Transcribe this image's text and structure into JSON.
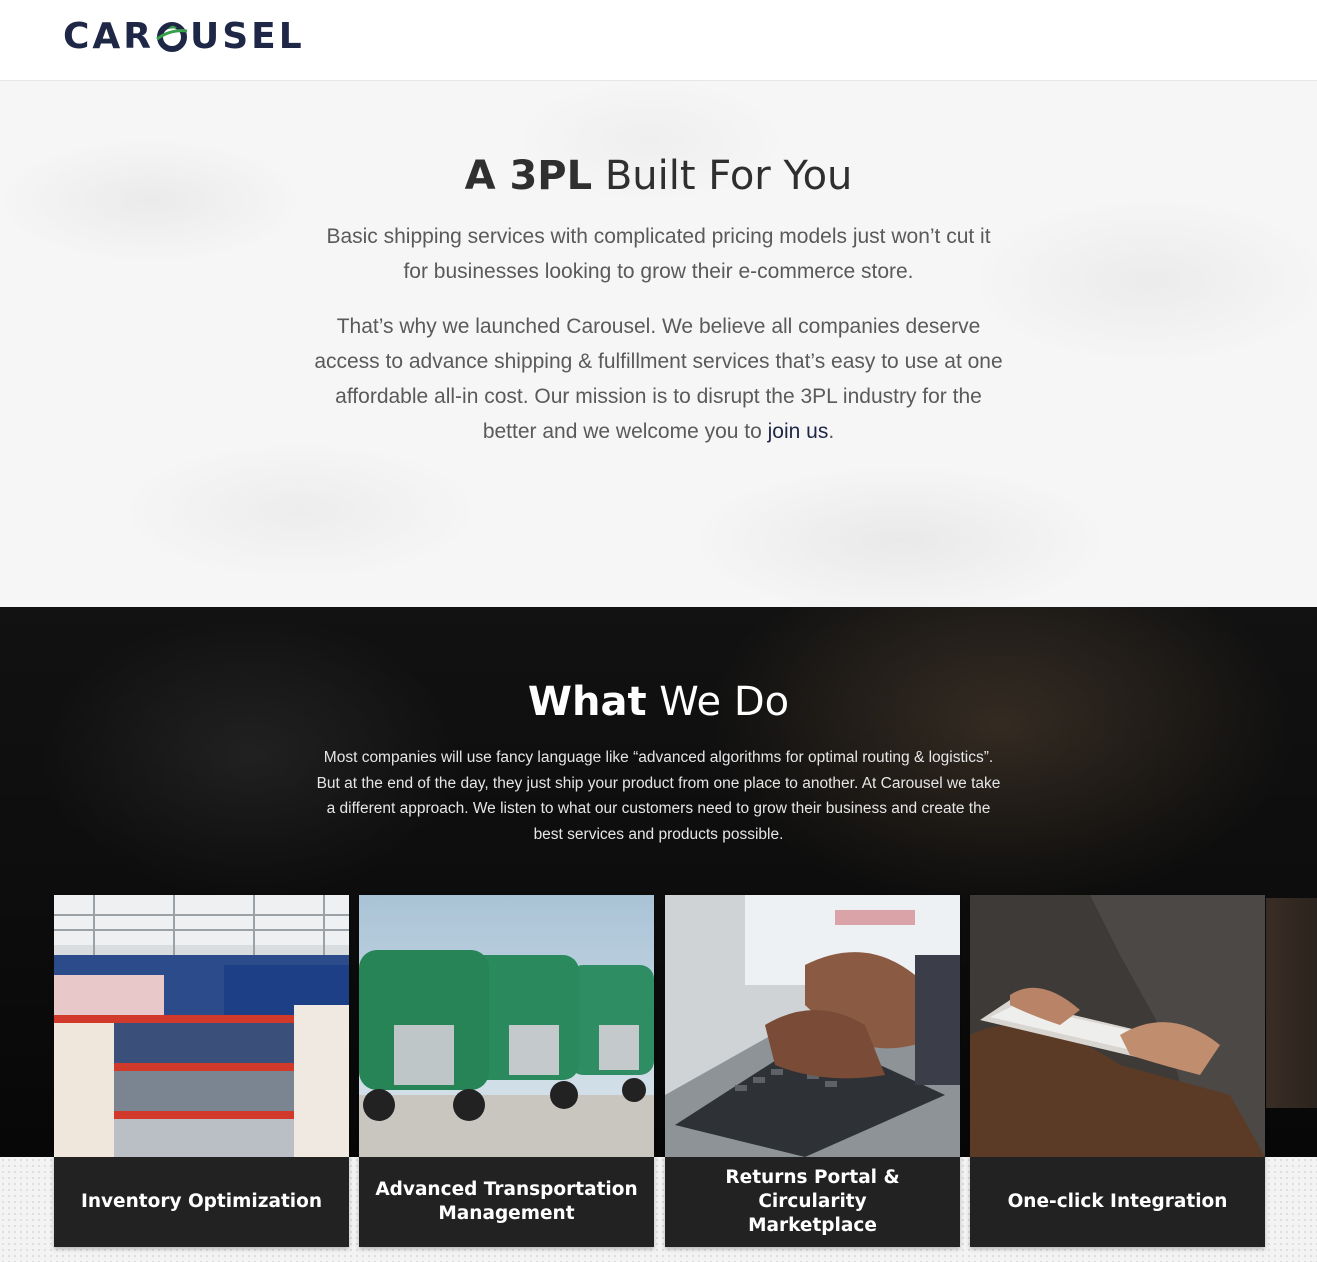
{
  "header": {
    "logo_text_left": "CAR",
    "logo_text_right": "USEL",
    "logo_alt": "CAROUSEL"
  },
  "intro": {
    "title_bold": "A 3PL",
    "title_rest": " Built For You",
    "paragraph1_line1": "Basic shipping services with complicated pricing models just won’t cut it",
    "paragraph1_line2": "for businesses looking to grow their e-commerce store.",
    "paragraph2_line1": "That’s why we launched Carousel. We believe all companies deserve",
    "paragraph2_line2": "access to advance shipping & fulfillment services that’s easy to use at one",
    "paragraph2_line3": "affordable all-in cost. Our mission is to disrupt the 3PL industry for the",
    "paragraph2_line4_pre": "better and we welcome you to ",
    "join_link": "join us",
    "paragraph2_line4_post": "."
  },
  "what_we_do": {
    "title_bold": "What",
    "title_rest": " We Do",
    "line1": "Most companies will use fancy language like “advanced algorithms for optimal routing & logistics”.",
    "line2": "But at the end of the day, they just ship your product from one place to another. At Carousel we take",
    "line3": "a different approach. We listen to what our customers need to grow their business and create the",
    "line4": "best services and products possible.",
    "cards": [
      {
        "label_line1": "Inventory Optimization",
        "label_line2": ""
      },
      {
        "label_line1": "Advanced Transportation",
        "label_line2": "Management"
      },
      {
        "label_line1": "Returns Portal & Circularity",
        "label_line2": "Marketplace"
      },
      {
        "label_line1": "One-click Integration",
        "label_line2": ""
      }
    ]
  },
  "colors": {
    "brand_navy": "#1f2747",
    "brand_green": "#3aa14b",
    "card_bg": "#222222",
    "section_dark": "#1b1b1b",
    "intro_bg": "#f6f6f6"
  },
  "icons": [
    "carousel-logo-o-icon"
  ]
}
